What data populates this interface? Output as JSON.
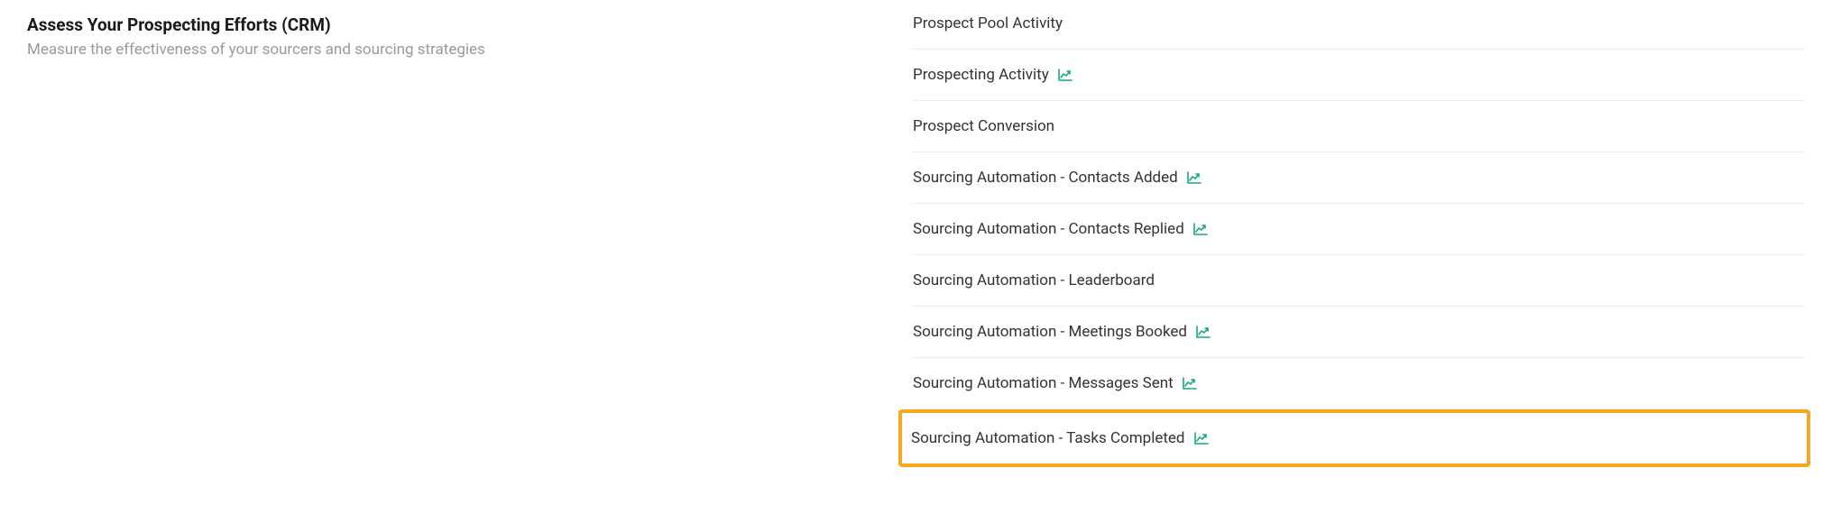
{
  "section": {
    "title": "Assess Your Prospecting Efforts (CRM)",
    "subtitle": "Measure the effectiveness of your sourcers and sourcing strategies"
  },
  "reports": [
    {
      "label": "Prospect Pool Activity",
      "hasChart": false,
      "highlighted": false
    },
    {
      "label": "Prospecting Activity",
      "hasChart": true,
      "highlighted": false
    },
    {
      "label": "Prospect Conversion",
      "hasChart": false,
      "highlighted": false
    },
    {
      "label": "Sourcing Automation - Contacts Added",
      "hasChart": true,
      "highlighted": false
    },
    {
      "label": "Sourcing Automation - Contacts Replied",
      "hasChart": true,
      "highlighted": false
    },
    {
      "label": "Sourcing Automation - Leaderboard",
      "hasChart": false,
      "highlighted": false
    },
    {
      "label": "Sourcing Automation - Meetings Booked",
      "hasChart": true,
      "highlighted": false
    },
    {
      "label": "Sourcing Automation - Messages Sent",
      "hasChart": true,
      "highlighted": false
    },
    {
      "label": "Sourcing Automation - Tasks Completed",
      "hasChart": true,
      "highlighted": true
    }
  ],
  "colors": {
    "chartIcon": "#15a87c",
    "highlight": "#f5a623"
  }
}
